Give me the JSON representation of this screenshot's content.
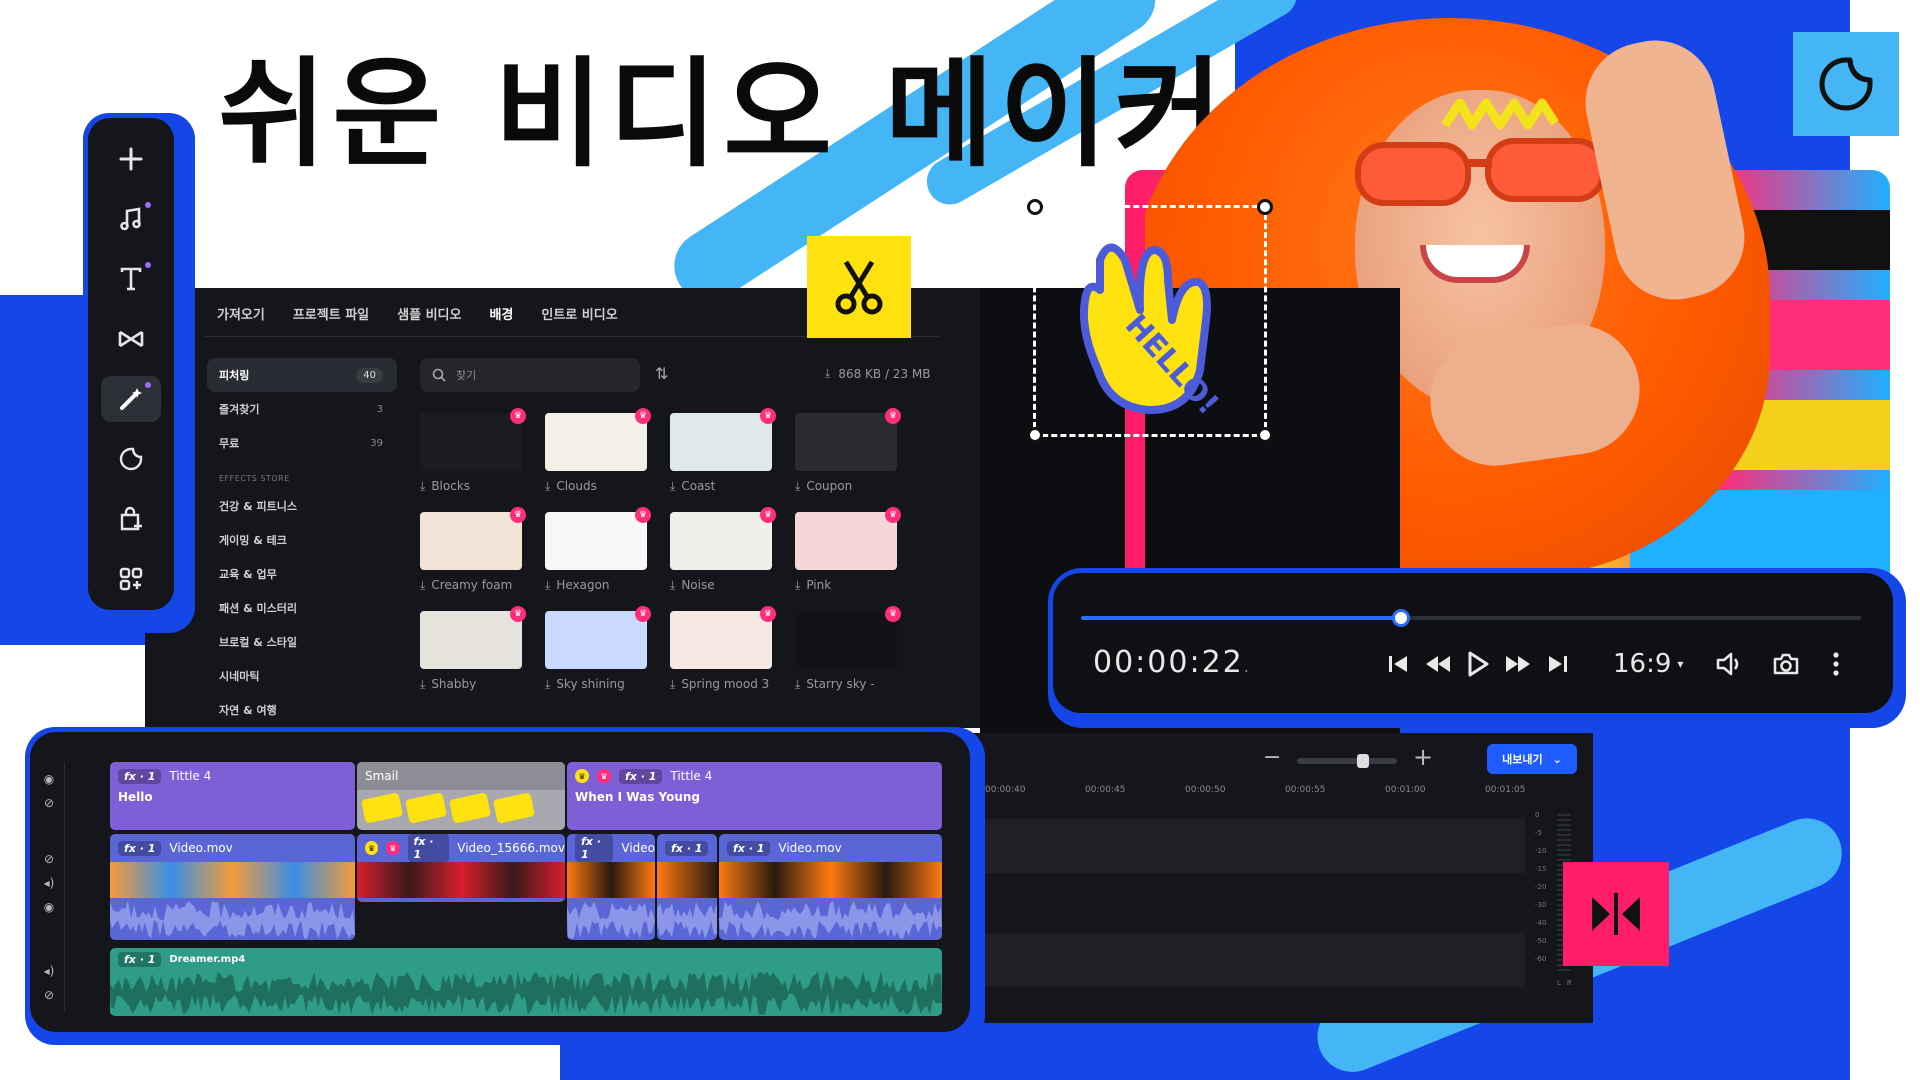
{
  "headline": "쉬운 비디오 메이커",
  "toolbar": {
    "items": [
      {
        "icon": "plus-icon",
        "name": "add"
      },
      {
        "icon": "music-icon",
        "name": "music",
        "dot": true
      },
      {
        "icon": "text-icon",
        "name": "text",
        "dot": true
      },
      {
        "icon": "transition-icon",
        "name": "transitions"
      },
      {
        "icon": "magic-wand-icon",
        "name": "effects",
        "dot": true,
        "active": true
      },
      {
        "icon": "sticker-icon",
        "name": "stickers"
      },
      {
        "icon": "store-icon",
        "name": "store"
      },
      {
        "icon": "apps-icon",
        "name": "templates"
      }
    ]
  },
  "library": {
    "tabs": [
      "가져오기",
      "프로젝트 파일",
      "샘플 비디오",
      "배경",
      "인트로 비디오"
    ],
    "active_tab": "배경",
    "sidebar": {
      "top": [
        {
          "label": "피처링",
          "count": "40",
          "active": true
        },
        {
          "label": "즐겨찾기",
          "count": "3"
        },
        {
          "label": "무료",
          "count": "39"
        }
      ],
      "section_title": "EFFECTS STORE",
      "store": [
        "건강 & 피트니스",
        "게이밍 & 테크",
        "교육 & 업무",
        "패션 & 미스터리",
        "브로컬 & 스타일",
        "시네마틱",
        "자연 & 여행"
      ]
    },
    "search_placeholder": "찾기",
    "storage": "868 KB / 23 MB",
    "items": [
      {
        "label": "Blocks",
        "bg": "#1b1c20"
      },
      {
        "label": "Clouds",
        "bg": "#f3f0e6"
      },
      {
        "label": "Coast",
        "bg": "#dfe9ea"
      },
      {
        "label": "Coupon",
        "bg": "#2a2b2f"
      },
      {
        "label": "Creamy foam",
        "bg": "#f1e3d6"
      },
      {
        "label": "Hexagon",
        "bg": "#f7f7f7"
      },
      {
        "label": "Noise",
        "bg": "#f1efec"
      },
      {
        "label": "Pink",
        "bg": "#f4d7d6"
      },
      {
        "label": "Shabby",
        "bg": "#e6e2dc"
      },
      {
        "label": "Sky shining",
        "bg": "#c9d9ff"
      },
      {
        "label": "Spring mood 3",
        "bg": "#f6e9e4"
      },
      {
        "label": "Starry sky -",
        "bg": "#111318"
      }
    ]
  },
  "sticker": {
    "text": "HELLO!"
  },
  "player": {
    "timecode": "00:00:22",
    "timecode_suffix": ".",
    "progress": 0.41,
    "aspect_ratio": "16:9"
  },
  "timeline_right": {
    "export_label": "내보내기",
    "ruler": [
      "00:00:40",
      "00:00:45",
      "00:00:50",
      "00:00:55",
      "00:01:00",
      "00:01:05"
    ],
    "meter_ticks": [
      "0",
      "-5",
      "-10",
      "-15",
      "-20",
      "-30",
      "-40",
      "-50",
      "-60"
    ],
    "meter_lr": [
      "L",
      "R"
    ]
  },
  "tracks": {
    "text_track": [
      {
        "fx": "fx · 1",
        "title": "Tittle 4",
        "text": "Hello"
      },
      {
        "title": "Smail"
      },
      {
        "fx": "fx · 1",
        "title": "Tittle 4",
        "text": "When I Was Young"
      }
    ],
    "video_track": [
      {
        "fx": "fx · 1",
        "title": "Video.mov"
      },
      {
        "fx": "fx · 1",
        "title": "Video_15666.mov"
      },
      {
        "fx": "fx · 1",
        "title": "Video"
      },
      {
        "fx": "fx · 1",
        "title": ""
      },
      {
        "fx": "fx · 1",
        "title": "Video.mov"
      }
    ],
    "audio_track": {
      "fx": "fx · 1",
      "title": "Dreamer.mp4"
    }
  },
  "colors": {
    "accent_blue": "#1446e8",
    "sky_blue": "#45b6f5",
    "yellow": "#fde210",
    "pink": "#ff1d6a",
    "text_clip": "#7f5fd6",
    "video_clip": "#5a66d6",
    "audio_clip": "#2e9c86"
  }
}
